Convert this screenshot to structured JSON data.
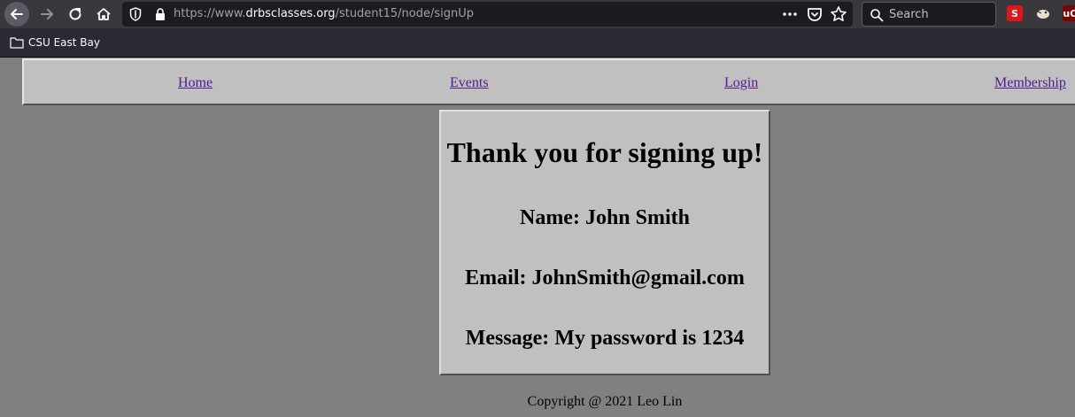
{
  "browser": {
    "url_prefix": "https://www.",
    "url_host": "drbsclasses.org",
    "url_path": "/student15/node/signUp",
    "search_placeholder": "Search",
    "bookmarks": [
      {
        "label": "CSU East Bay"
      }
    ],
    "extensions": {
      "s_label": "S",
      "ub_label": "uO"
    }
  },
  "site_nav": {
    "items": [
      {
        "label": "Home"
      },
      {
        "label": "Events"
      },
      {
        "label": "Login"
      },
      {
        "label": "Membership"
      }
    ]
  },
  "card": {
    "heading": "Thank you for signing up!",
    "name_line": "Name: John Smith",
    "email_line": "Email: JohnSmith@gmail.com",
    "message_line": "Message: My password is 1234"
  },
  "footer": {
    "copyright": "Copyright @ 2021 Leo Lin"
  },
  "colors": {
    "page_bg": "#808080",
    "panel_bg": "#c0c0c0",
    "link_visited": "#551a8b",
    "chrome_bg": "#38383d"
  }
}
